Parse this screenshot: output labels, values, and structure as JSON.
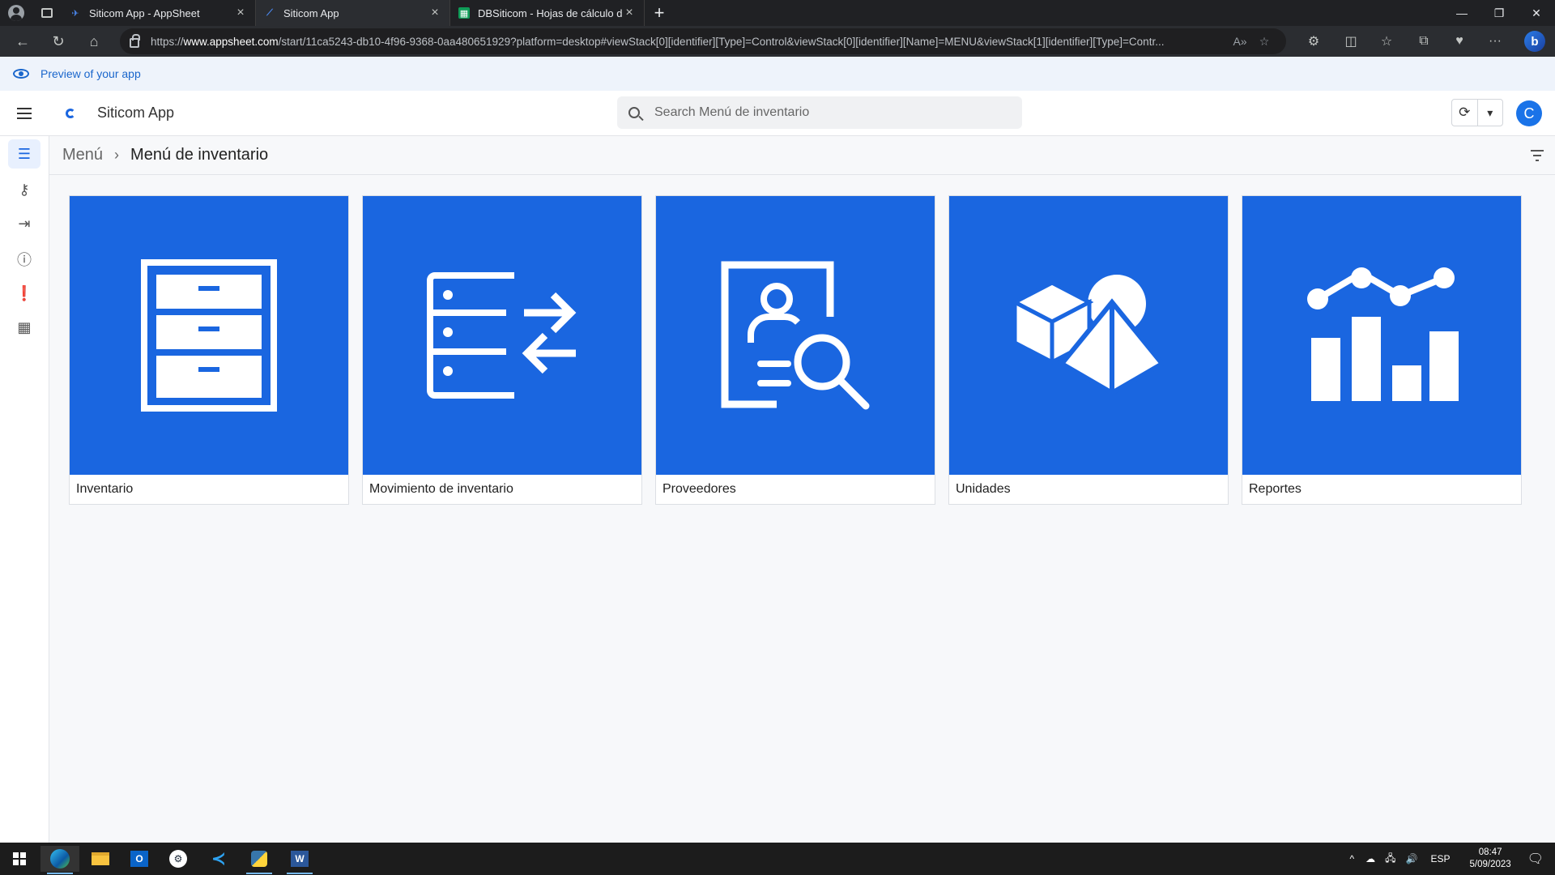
{
  "browser": {
    "tabs": [
      {
        "title": "Siticom App - AppSheet",
        "active": false
      },
      {
        "title": "Siticom App",
        "active": true
      },
      {
        "title": "DBSiticom - Hojas de cálculo de",
        "active": false
      }
    ],
    "url_prefix": "https://",
    "url_host": "www.appsheet.com",
    "url_rest": "/start/11ca5243-db10-4f96-9368-0aa480651929?platform=desktop#viewStack[0][identifier][Type]=Control&viewStack[0][identifier][Name]=MENU&viewStack[1][identifier][Type]=Contr..."
  },
  "preview_banner": "Preview of your app",
  "app": {
    "name": "Siticom App",
    "search_placeholder": "Search Menú de inventario",
    "avatar_letter": "C"
  },
  "breadcrumb": {
    "parent": "Menú",
    "current": "Menú de inventario"
  },
  "cards": [
    {
      "label": "Inventario",
      "icon": "file-cabinet-icon"
    },
    {
      "label": "Movimiento de inventario",
      "icon": "inventory-movement-icon"
    },
    {
      "label": "Proveedores",
      "icon": "supplier-search-icon"
    },
    {
      "label": "Unidades",
      "icon": "shapes-icon"
    },
    {
      "label": "Reportes",
      "icon": "chart-report-icon"
    }
  ],
  "colors": {
    "tile": "#1a66e0",
    "accent": "#1a73e8"
  },
  "taskbar": {
    "language": "ESP",
    "time": "08:47",
    "date": "5/09/2023"
  }
}
